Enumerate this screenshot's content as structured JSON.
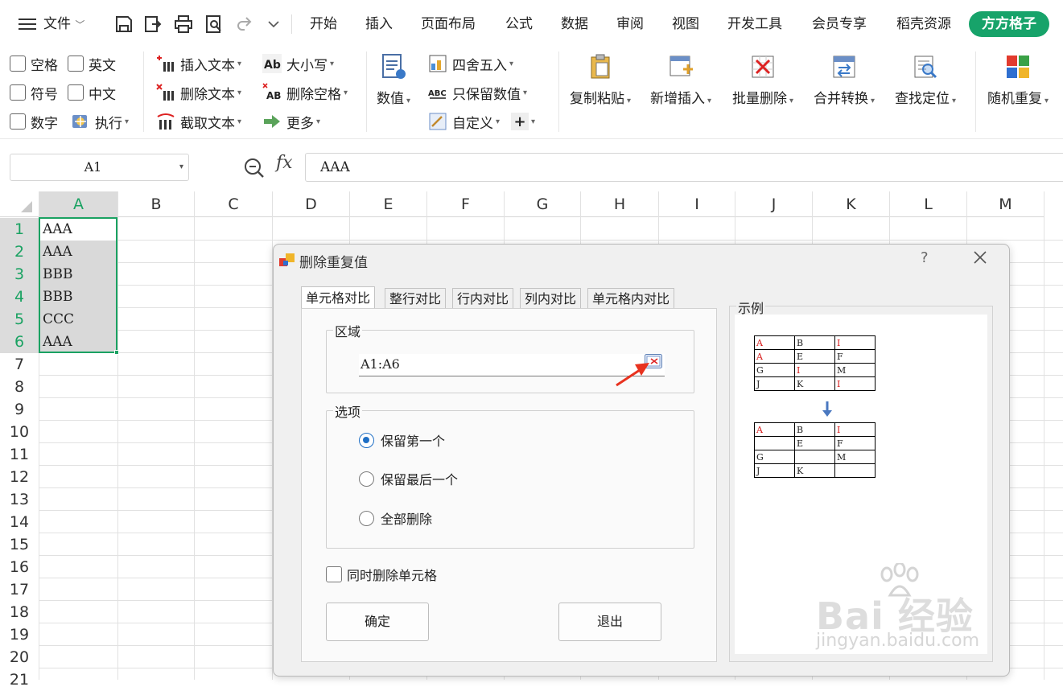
{
  "menubar": {
    "file": "文件",
    "tabs": [
      "开始",
      "插入",
      "页面布局",
      "公式",
      "数据",
      "审阅",
      "视图",
      "开发工具",
      "会员专享",
      "稻壳资源"
    ],
    "brand_tab": "方方格子",
    "brand_color": "#17a36a"
  },
  "ribbon": {
    "check_items": [
      "空格",
      "英文",
      "符号",
      "中文",
      "数字"
    ],
    "execute": "执行",
    "text_ops": [
      "插入文本",
      "删除文本",
      "截取文本"
    ],
    "case_ops": [
      "大小写",
      "删除空格",
      "更多"
    ],
    "value_btn": "数值",
    "round_ops": [
      "四舍五入",
      "只保留数值",
      "自定义"
    ],
    "big_buttons": [
      "复制粘贴",
      "新增插入",
      "批量删除",
      "合并转换",
      "查找定位",
      "随机重复"
    ],
    "icons": [
      "ab-case-icon",
      "ab-remove-space-icon",
      "arrow-more-icon",
      "insert-text-icon",
      "delete-text-icon",
      "cut-text-icon"
    ]
  },
  "formula_bar": {
    "name_box": "A1",
    "fx": "fx",
    "value": "AAA"
  },
  "sheet": {
    "columns": [
      "A",
      "B",
      "C",
      "D",
      "E",
      "F",
      "G",
      "H",
      "I",
      "J",
      "K",
      "L",
      "M"
    ],
    "rows": [
      "1",
      "2",
      "3",
      "4",
      "5",
      "6",
      "7",
      "8",
      "9",
      "10",
      "11",
      "12",
      "13",
      "14",
      "15",
      "16",
      "17",
      "18",
      "19",
      "20",
      "21"
    ],
    "cells_a": [
      "AAA",
      "AAA",
      "BBB",
      "BBB",
      "CCC",
      "AAA"
    ],
    "selection_color": "#1aa262"
  },
  "dialog": {
    "title": "删除重复值",
    "help": "?",
    "tabs": [
      "单元格对比",
      "整行对比",
      "行内对比",
      "列内对比",
      "单元格内对比"
    ],
    "range_group": "区域",
    "range_value": "A1:A6",
    "options_group": "选项",
    "options": [
      "保留第一个",
      "保留最后一个",
      "全部删除"
    ],
    "selected_option": "保留第一个",
    "checkbox": "同时删除单元格",
    "ok": "确定",
    "exit": "退出",
    "example_label": "示例",
    "example_before": [
      [
        "A",
        "B",
        "I"
      ],
      [
        "A",
        "E",
        "F"
      ],
      [
        "G",
        "I",
        "M"
      ],
      [
        "J",
        "K",
        "I"
      ]
    ],
    "example_after": [
      [
        "A",
        "B",
        "I"
      ],
      [
        "",
        "E",
        "F"
      ],
      [
        "G",
        "",
        "M"
      ],
      [
        "J",
        "K",
        ""
      ]
    ]
  },
  "watermark": {
    "logo": "Bai 经验",
    "url": "jingyan.baidu.com"
  }
}
